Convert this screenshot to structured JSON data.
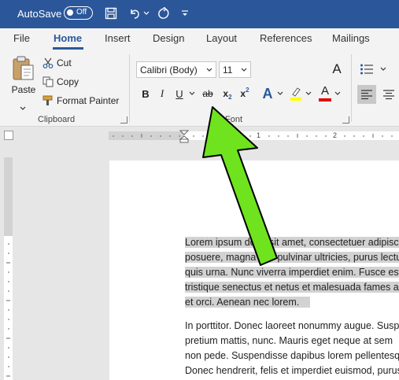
{
  "titlebar": {
    "autosave_label": "AutoSave",
    "toggle_label": "Off",
    "accent": "#2b579a"
  },
  "tabs": [
    "File",
    "Home",
    "Insert",
    "Design",
    "Layout",
    "References",
    "Mailings"
  ],
  "active_tab": "Home",
  "clipboard": {
    "paste": "Paste",
    "cut": "Cut",
    "copy": "Copy",
    "format_painter": "Format Painter",
    "group_label": "Clipboard"
  },
  "font": {
    "family": "Calibri (Body)",
    "size": "11",
    "group_label": "Font",
    "bold": "B",
    "italic": "I",
    "underline": "U",
    "strikethrough": "ab",
    "subscript": "x",
    "subscript_sub": "2",
    "superscript": "x",
    "superscript_sup": "2",
    "text_effects": "A",
    "font_color": "A",
    "grow_font": "A"
  },
  "ruler": {
    "one": "1",
    "two": "2"
  },
  "document": {
    "para1": [
      "Lorem ipsum dolor sit amet, consectetuer adipiscing",
      "posuere, magna sed pulvinar ultricies, purus lectus",
      "quis urna. Nunc viverra imperdiet enim. Fusce est.",
      "tristique senectus et netus et malesuada fames ac",
      "et orci. Aenean nec lorem."
    ],
    "para2": [
      "In porttitor. Donec laoreet nonummy augue. Suspendisse",
      "pretium mattis, nunc. Mauris eget neque at sem",
      "non pede. Suspendisse dapibus lorem pellentesque",
      "Donec hendrerit, felis et imperdiet euismod, purus"
    ]
  },
  "colors": {
    "highlight": "#ffff00",
    "font_color": "#e00000",
    "arrow": "#6fe31e"
  }
}
